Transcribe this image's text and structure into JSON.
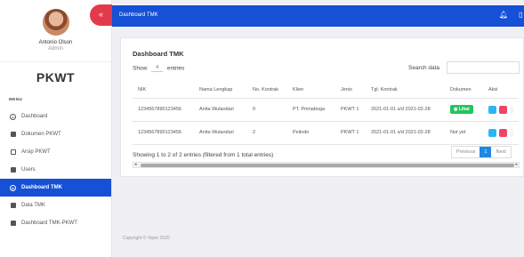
{
  "profile": {
    "name": "Antonio Olson",
    "role": "Admin"
  },
  "brand": "PKWT",
  "menu_title": "MENU",
  "sidebar": {
    "items": [
      {
        "label": "Dashboard",
        "icon": "dashboard-icon",
        "active": false
      },
      {
        "label": "Dokumen PKWT",
        "icon": "document-icon",
        "active": false
      },
      {
        "label": "Arsip PKWT",
        "icon": "archive-icon",
        "active": false
      },
      {
        "label": "Users",
        "icon": "users-icon",
        "active": false
      },
      {
        "label": "Dashboard TMK",
        "icon": "dashboard-icon",
        "active": true
      },
      {
        "label": "Data TMK",
        "icon": "data-icon",
        "active": false
      },
      {
        "label": "Dashboard TMK-PKWT",
        "icon": "dashboard-icon",
        "active": false
      }
    ]
  },
  "toggle_symbol": "«",
  "topbar": {
    "title": "Dashboard TMK"
  },
  "card": {
    "title": "Dashboard TMK",
    "show_label": "Show",
    "show_value": "4",
    "entries_label": "entries",
    "search_label": "Search data",
    "search_value": ""
  },
  "table": {
    "headers": [
      "NIK",
      "Nama Lengkap",
      "No. Kontrak",
      "Klien",
      "Jenis",
      "Tgl. Kontrak",
      "Dokumen",
      "Aksi"
    ],
    "rows": [
      {
        "nik": "1234567890123456",
        "nama": "Anita Wulandari",
        "no_kontrak": "0",
        "klien": "PT. Primaboga",
        "jenis": "PKWT 1",
        "tgl": "2021-01-01 s/d 2021-02-28",
        "dokumen": "Lihat",
        "dokumen_badge": true
      },
      {
        "nik": "1234567890123456",
        "nama": "Anita Wulandari",
        "no_kontrak": "2",
        "klien": "Pelindo",
        "jenis": "PKWT 1",
        "tgl": "2021-01-01 s/d 2021-02-28",
        "dokumen": "Not yet",
        "dokumen_badge": false
      }
    ]
  },
  "info": "Showing 1 to 2 of 2 entries (filtered from 1 total entries)",
  "pager": {
    "previous": "Previous",
    "current": "1",
    "next": "Next"
  },
  "footer": "Copyright © Yopie 2020",
  "colors": {
    "primary": "#1550d6",
    "toggle": "#e23a4c",
    "success": "#22c55e",
    "info": "#29b6f6",
    "danger": "#ef4564"
  }
}
